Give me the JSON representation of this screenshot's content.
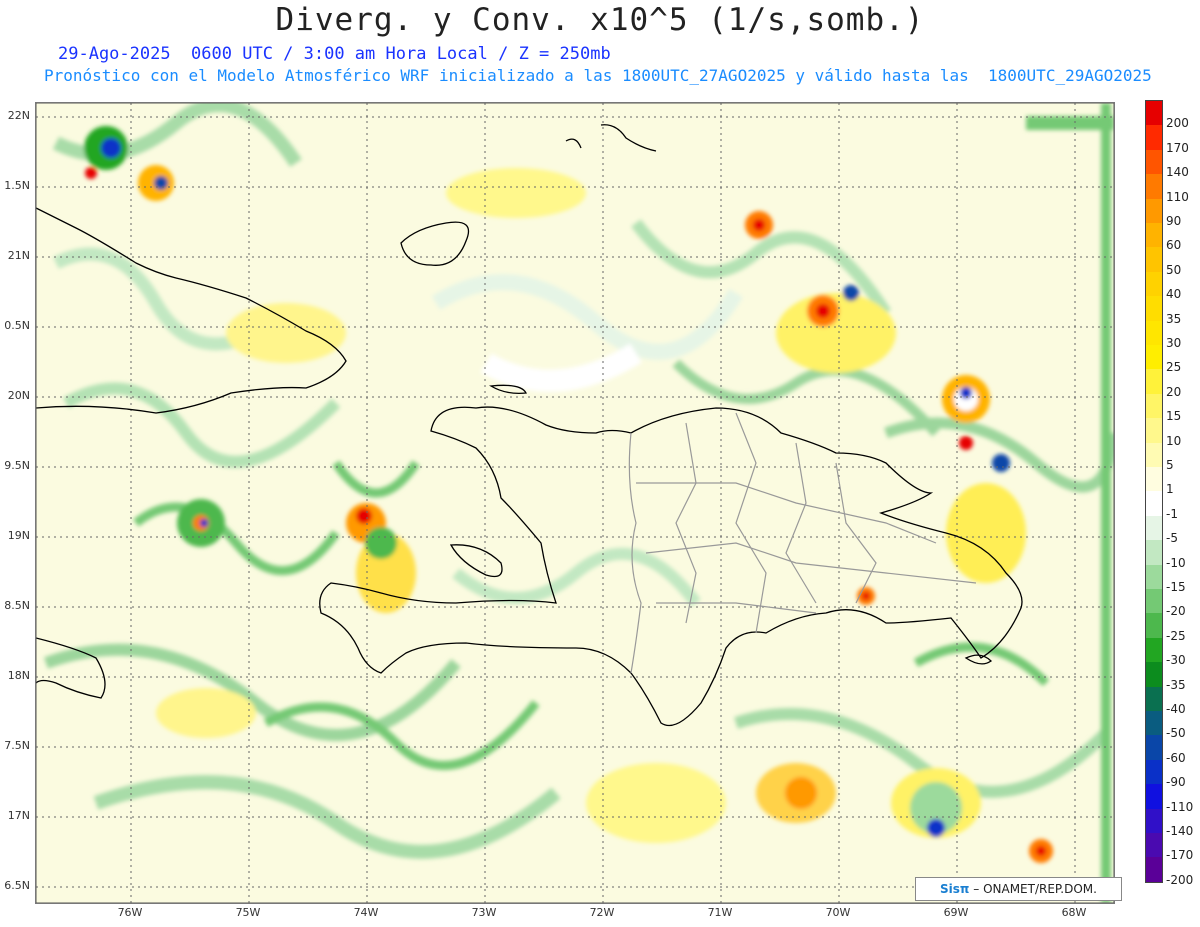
{
  "title": "Diverg. y Conv. x10^5 (1/s,somb.)",
  "subtitle_date": "29-Ago-2025  0600 UTC / 3:00 am Hora Local / Z = 250mb",
  "subtitle_model": "Pronóstico con el Modelo Atmosférico WRF inicializado a las 1800UTC_27AGO2025 y válido hasta las  1800UTC_29AGO2025",
  "lat_labels": [
    "22N",
    "1.5N",
    "21N",
    "0.5N",
    "20N",
    "9.5N",
    "19N",
    "8.5N",
    "18N",
    "7.5N",
    "17N",
    "6.5N"
  ],
  "lon_labels": [
    "76W",
    "75W",
    "74W",
    "73W",
    "72W",
    "71W",
    "70W",
    "69W",
    "68W"
  ],
  "colorbar": {
    "labels": [
      "200",
      "170",
      "140",
      "110",
      "90",
      "60",
      "50",
      "40",
      "35",
      "30",
      "25",
      "20",
      "15",
      "10",
      "5",
      "1",
      "-1",
      "-5",
      "-10",
      "-15",
      "-20",
      "-25",
      "-30",
      "-35",
      "-40",
      "-50",
      "-60",
      "-90",
      "-110",
      "-140",
      "-170",
      "-200"
    ],
    "colors": [
      "#e60000",
      "#ff2a00",
      "#ff5500",
      "#ff7a00",
      "#ff9900",
      "#ffb300",
      "#ffc400",
      "#ffd200",
      "#ffdd00",
      "#ffe600",
      "#ffee00",
      "#fff23a",
      "#fff566",
      "#fff88c",
      "#fffbb3",
      "#fffde0",
      "#ffffff",
      "#e6f5e6",
      "#c2e8c2",
      "#9cda9c",
      "#74c974",
      "#4db84d",
      "#22a622",
      "#0c8c1e",
      "#0a7050",
      "#0a5c80",
      "#0a46a8",
      "#0a30c8",
      "#1010e0",
      "#3010c8",
      "#4a0ab0",
      "#5a0098"
    ]
  },
  "credit": {
    "logo": "Sisπ",
    "text": "– ONAMET/REP.DOM."
  }
}
